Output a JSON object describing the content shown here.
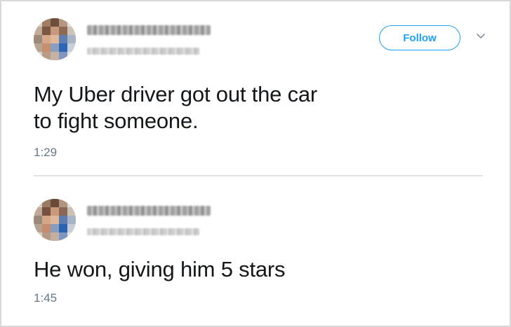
{
  "tweets": [
    {
      "follow_label": "Follow",
      "text_line1": "My Uber driver got out the car",
      "text_line2": "to fight someone.",
      "time": "1:29",
      "menu_icon": "chevron-down-icon"
    },
    {
      "text": "He won, giving him 5 stars",
      "time": "1:45"
    }
  ],
  "colors": {
    "accent": "#1da1f2",
    "text": "#14171a",
    "muted": "#657786",
    "divider": "#e1e1e1"
  }
}
